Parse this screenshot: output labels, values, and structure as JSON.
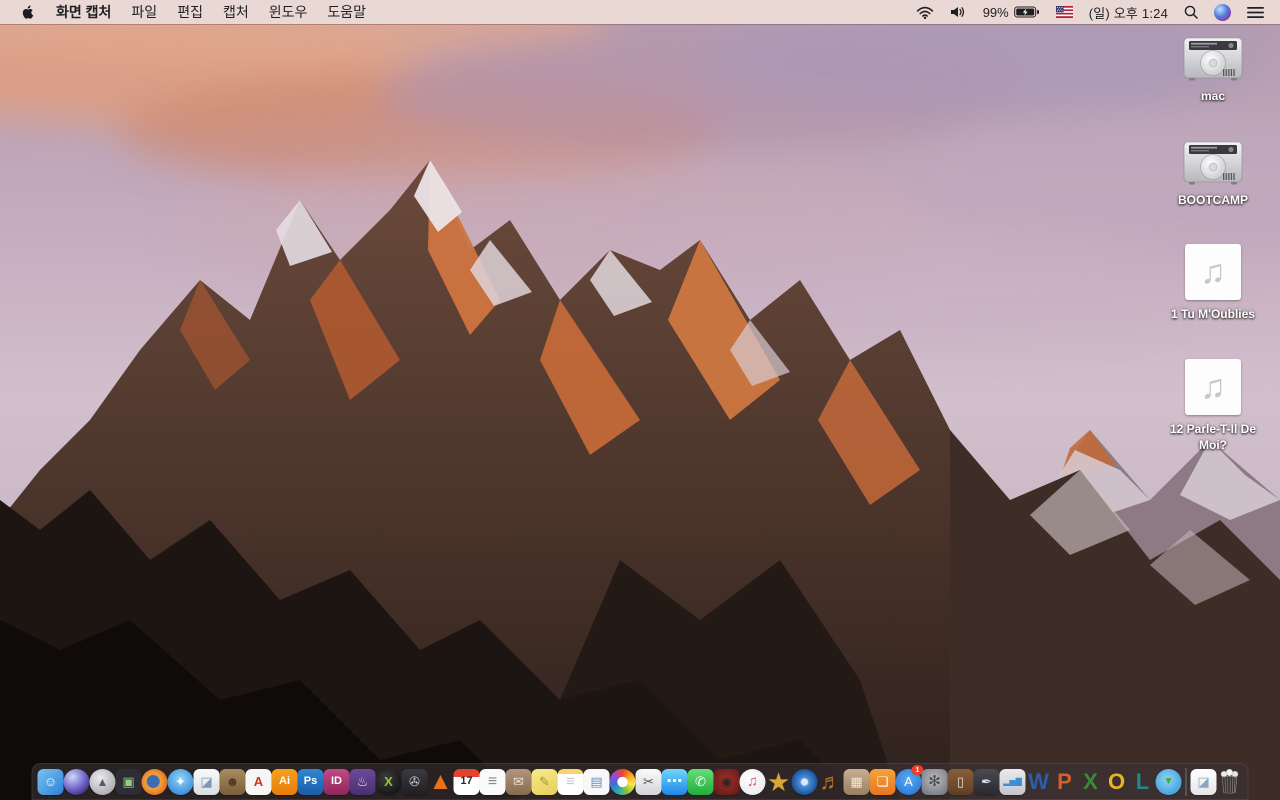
{
  "menu_bar": {
    "app_name": "화면 캡처",
    "menus": [
      "파일",
      "편집",
      "캡처",
      "윈도우",
      "도움말"
    ],
    "status": {
      "battery_percent": "99%",
      "clock": "(일) 오후 1:24"
    },
    "colors": {
      "bar_bg": "#ead8d4",
      "text": "#1f1f21"
    }
  },
  "desktop": {
    "icons": [
      {
        "name": "drive-mac",
        "type": "drive",
        "label": "mac"
      },
      {
        "name": "drive-bootcamp",
        "type": "drive",
        "label": "BOOTCAMP"
      },
      {
        "name": "audio-file-1",
        "type": "audio",
        "label": "1 Tu M'Oublies"
      },
      {
        "name": "audio-file-2",
        "type": "audio",
        "label": "12 Parle-T-Il De Moi?"
      }
    ]
  },
  "dock": {
    "panel_color": "rgba(58,52,54,0.58)",
    "items": [
      {
        "name": "finder",
        "glyph": "☺",
        "fg": "#ffffff",
        "bg": "linear-gradient(135deg,#7cc1f2,#2b80d5)",
        "shape": "rsq",
        "running": true
      },
      {
        "name": "siri",
        "glyph": "",
        "bg": "radial-gradient(circle at 35% 30%,#cfd9f6,#7a6fd0 45%,#35276e 85%)",
        "shape": "circle"
      },
      {
        "name": "launchpad",
        "glyph": "▲",
        "fg": "#5a5a60",
        "bg": "radial-gradient(circle at 40% 35%,#ececee,#97979e)",
        "shape": "circle",
        "size": 12
      },
      {
        "name": "mission-control",
        "glyph": "▣",
        "fg": "#8fd07e",
        "bg": "#2d2d33",
        "shape": "rsq"
      },
      {
        "name": "firefox",
        "glyph": "",
        "bg": "radial-gradient(circle at 45% 48%,#3f6cb0 30%,#f0a43c 36%,#e2641c 78%)",
        "shape": "circle"
      },
      {
        "name": "safari",
        "glyph": "✦",
        "fg": "#ffffff",
        "bg": "radial-gradient(circle at 50% 38%,#91d5f8,#2079d2)",
        "shape": "circle"
      },
      {
        "name": "preview",
        "glyph": "◪",
        "fg": "#7e96b5",
        "bg": "linear-gradient(180deg,#fafafa,#d9dee3)",
        "shape": "rsq"
      },
      {
        "name": "contacts",
        "glyph": "☻",
        "fg": "#4a3a22",
        "bg": "linear-gradient(180deg,#a98b5f,#7a5f3a)",
        "shape": "rsq"
      },
      {
        "name": "acrobat-reader",
        "glyph": "A",
        "fg": "#d6301f",
        "bg": "#f6f6f6",
        "shape": "rsq",
        "bold": true
      },
      {
        "name": "illustrator",
        "glyph": "Ai",
        "fg": "#ffffff",
        "bg": "linear-gradient(180deg,#f6a01c,#e67c0d)",
        "shape": "rsq",
        "bold": true,
        "size": 11
      },
      {
        "name": "photoshop",
        "glyph": "Ps",
        "fg": "#ffffff",
        "bg": "linear-gradient(180deg,#2f87d2,#1a5ea6)",
        "shape": "rsq",
        "bold": true,
        "size": 11
      },
      {
        "name": "indesign",
        "glyph": "ID",
        "fg": "#ffffff",
        "bg": "linear-gradient(180deg,#c14a85,#8f265a)",
        "shape": "rsq",
        "bold": true,
        "size": 11
      },
      {
        "name": "toast-titanium",
        "glyph": "♨",
        "fg": "#e9e0f6",
        "bg": "linear-gradient(180deg,#6a4a9a,#483070)",
        "shape": "rsq"
      },
      {
        "name": "xbmc",
        "glyph": "X",
        "fg": "#8fc43c",
        "bg": "radial-gradient(circle at 40% 35%,#3c3c3c,#0a0a0a)",
        "shape": "circle",
        "bold": true
      },
      {
        "name": "disk-monitor",
        "glyph": "✇",
        "fg": "#cbcbd3",
        "bg": "linear-gradient(180deg,#3b3b41,#1e1e23)",
        "shape": "rsq"
      },
      {
        "name": "vlc",
        "glyph": "▲",
        "fg": "#e8721a",
        "shape": "none",
        "size": 24
      },
      {
        "name": "calendar",
        "glyph": "17",
        "fg": "#2a2a2a",
        "bg": "linear-gradient(180deg,#e2432e 0%,#e2432e 30%,#ffffff 30%)",
        "shape": "rsq",
        "bold": true,
        "size": 11
      },
      {
        "name": "reminders",
        "glyph": "≡",
        "fg": "#8a8a8a",
        "bg": "#fafafa",
        "shape": "rsq",
        "size": 16
      },
      {
        "name": "archive-box",
        "glyph": "✉",
        "fg": "#ece4d7",
        "bg": "linear-gradient(180deg,#b2957a,#876b50)",
        "shape": "rsq"
      },
      {
        "name": "stickies",
        "glyph": "✎",
        "fg": "#a8922f",
        "bg": "linear-gradient(160deg,#f8ea8c,#e7ce58)",
        "shape": "rsq"
      },
      {
        "name": "notes",
        "glyph": "≡",
        "fg": "#c9c9c9",
        "bg": "linear-gradient(180deg,#f4d66c 0%,#f4d66c 20%,#ffffff 20%)",
        "shape": "rsq",
        "size": 15
      },
      {
        "name": "documents-app",
        "glyph": "▤",
        "fg": "#5b90d5",
        "bg": "#f8f8f8",
        "shape": "rsq"
      },
      {
        "name": "photos",
        "glyph": "",
        "bg": "radial-gradient(circle,#ffffff 27%,rgba(255,255,255,0) 29%),conic-gradient(#e8452d,#f5a623,#f6e84a,#8fc43a,#29a8b8,#3a6fd4,#9a4ad4,#e8452d)",
        "shape": "circle"
      },
      {
        "name": "grab-screen-capture",
        "glyph": "✂",
        "fg": "#4f4f55",
        "bg": "linear-gradient(180deg,#fbfbfb,#d4d4d9)",
        "shape": "rsq",
        "running": true
      },
      {
        "name": "messages",
        "glyph": "⋯",
        "fg": "#ffffff",
        "bg": "linear-gradient(180deg,#6fd5f8,#1f86e8)",
        "shape": "rsq",
        "bold": true,
        "size": 16
      },
      {
        "name": "facetime",
        "glyph": "✆",
        "fg": "#ffffff",
        "bg": "linear-gradient(180deg,#67df78,#1fac3a)",
        "shape": "rsq"
      },
      {
        "name": "photo-booth",
        "glyph": "◉",
        "fg": "#35201e",
        "bg": "radial-gradient(circle at 50% 45%,#a03028,#5c1a17)",
        "shape": "rsq"
      },
      {
        "name": "itunes",
        "glyph": "♫",
        "fg": "#e84a80",
        "bg": "radial-gradient(circle at 40% 35%,#ffffff,#e6e6ee)",
        "shape": "circle",
        "size": 15
      },
      {
        "name": "imovie",
        "glyph": "★",
        "fg": "#d9a438",
        "shape": "none",
        "size": 26
      },
      {
        "name": "dvd-player",
        "glyph": "",
        "bg": "radial-gradient(circle at 50% 50%,#dde9f6 16%,#4a90d5 24%,#1a4f9a 72%,#0e3a77)",
        "shape": "circle"
      },
      {
        "name": "garageband",
        "glyph": "♬",
        "fg": "#b5762a",
        "shape": "none",
        "size": 22
      },
      {
        "name": "iweb-collage",
        "glyph": "▦",
        "fg": "#f0e8da",
        "bg": "linear-gradient(180deg,#c8af91,#977f61)",
        "shape": "rsq"
      },
      {
        "name": "ibooks",
        "glyph": "❏",
        "fg": "#ffffff",
        "bg": "linear-gradient(180deg,#f6a33b,#e7761f)",
        "shape": "rsq"
      },
      {
        "name": "app-store",
        "glyph": "A",
        "fg": "#ffffff",
        "bg": "radial-gradient(circle at 50% 38%,#5caaf1,#1f6fd3)",
        "shape": "circle",
        "badge": "1"
      },
      {
        "name": "system-preferences",
        "glyph": "✻",
        "fg": "#4b4b52",
        "bg": "radial-gradient(circle at 50% 40%,#bcbcc2,#6e6e77)",
        "shape": "rsq",
        "size": 15
      },
      {
        "name": "keynote",
        "glyph": "▯",
        "fg": "#e9ddc8",
        "bg": "linear-gradient(180deg,#8a5f3a,#5e3f25)",
        "shape": "rsq"
      },
      {
        "name": "pages",
        "glyph": "✒",
        "fg": "#d9d9e1",
        "bg": "linear-gradient(180deg,#4a4a53,#29292f)",
        "shape": "rsq"
      },
      {
        "name": "numbers",
        "glyph": "▂▅▇",
        "fg": "#3a8fd4",
        "bg": "linear-gradient(180deg,#ececef,#c4c4cb)",
        "shape": "rsq",
        "size": 8
      },
      {
        "name": "word",
        "glyph": "W",
        "fg": "#2b5fa9",
        "shape": "none",
        "bold": true,
        "size": 22
      },
      {
        "name": "powerpoint",
        "glyph": "P",
        "fg": "#d55f2a",
        "shape": "none",
        "bold": true,
        "size": 22
      },
      {
        "name": "excel",
        "glyph": "X",
        "fg": "#3a8a3b",
        "shape": "none",
        "bold": true,
        "size": 22
      },
      {
        "name": "outlook",
        "glyph": "O",
        "fg": "#e9b51f",
        "shape": "none",
        "bold": true,
        "size": 22
      },
      {
        "name": "lync",
        "glyph": "L",
        "fg": "#1f8a8a",
        "shape": "none",
        "bold": true,
        "size": 22
      },
      {
        "name": "web-downloader",
        "glyph": "▼",
        "fg": "#3aa83b",
        "bg": "radial-gradient(circle at 45% 40%,#90d5f1,#2a8fd5)",
        "shape": "circle",
        "size": 10
      },
      {
        "sep": true
      },
      {
        "name": "document-file",
        "glyph": "◪",
        "fg": "#8aa6c5",
        "bg": "linear-gradient(180deg,#ffffff,#e6e6e9)",
        "shape": "rsq"
      },
      {
        "name": "trash",
        "kind": "trash",
        "shape": "none"
      }
    ]
  }
}
